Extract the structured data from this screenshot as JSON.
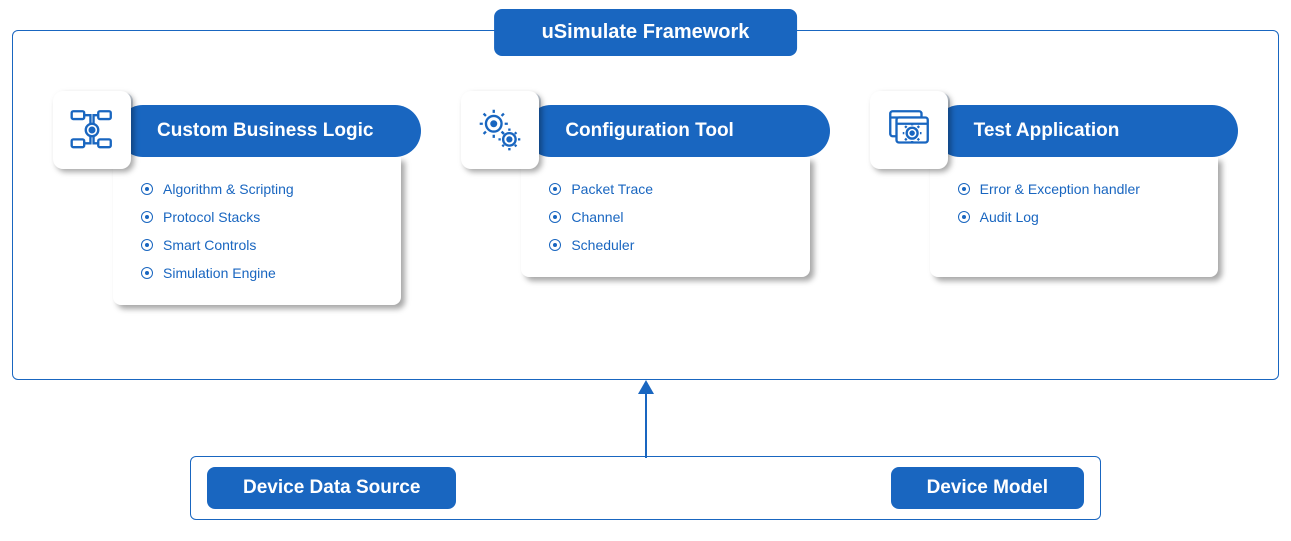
{
  "framework": {
    "title": "uSimulate Framework"
  },
  "cards": [
    {
      "icon": "flow-icon",
      "title": "Custom Business Logic",
      "items": [
        "Algorithm & Scripting",
        "Protocol Stacks",
        "Smart Controls",
        "Simulation Engine"
      ]
    },
    {
      "icon": "gears-icon",
      "title": "Configuration Tool",
      "items": [
        "Packet Trace",
        "Channel",
        "Scheduler"
      ]
    },
    {
      "icon": "app-gear-icon",
      "title": "Test Application",
      "items": [
        "Error & Exception handler",
        "Audit Log"
      ]
    }
  ],
  "bottom": {
    "left": "Device Data Source",
    "right": "Device Model"
  }
}
